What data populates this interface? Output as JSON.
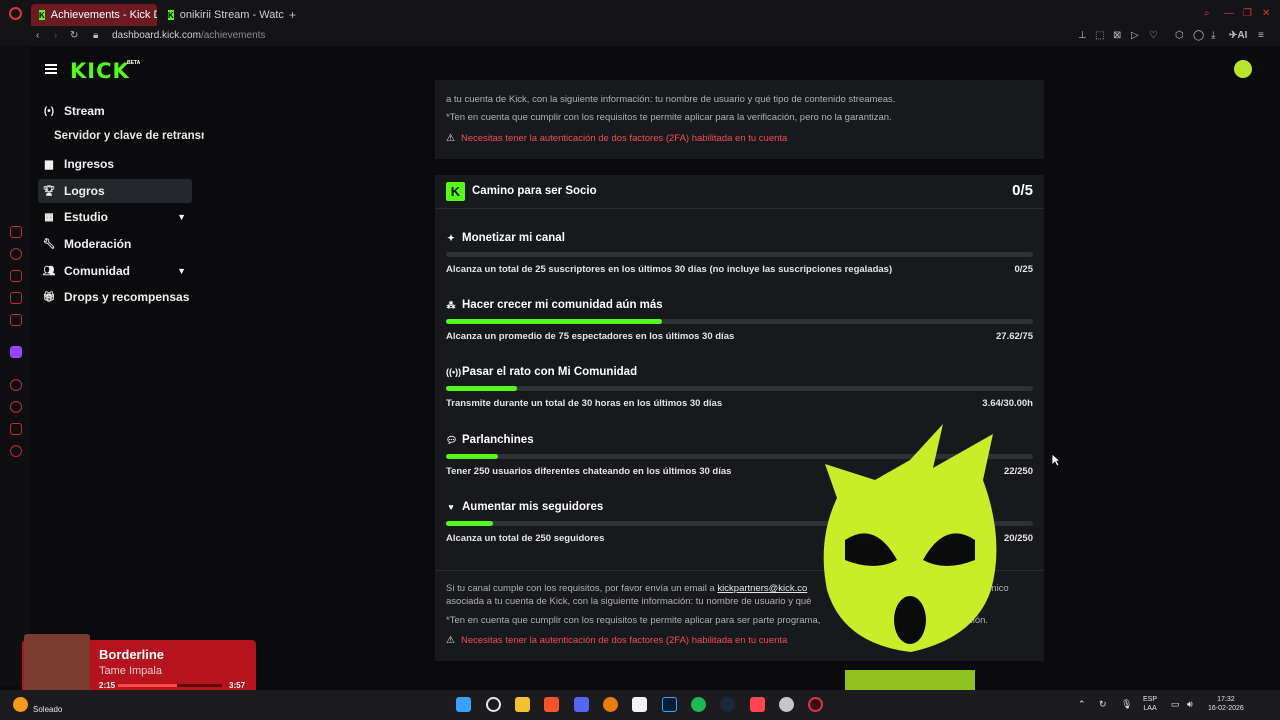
{
  "browser": {
    "tabs": [
      {
        "label": "Achievements - Kick Dash"
      },
      {
        "label": "onikirii Stream - Watch Liv"
      }
    ],
    "new_tab": "+",
    "url_domain": "dashboard.kick.com",
    "url_path": "/achievements"
  },
  "header": {
    "logo": "KICK",
    "logo_beta": "BETA"
  },
  "nav": {
    "items": [
      {
        "label": "Stream",
        "icon": "broadcast-icon"
      },
      {
        "label": "Servidor y clave de retransmisión",
        "icon": ""
      },
      {
        "label": "Ingresos",
        "icon": "chart-icon"
      },
      {
        "label": "Logros",
        "icon": "trophy-icon"
      },
      {
        "label": "Estudio",
        "icon": "studio-icon"
      },
      {
        "label": "Moderación",
        "icon": "wrench-icon"
      },
      {
        "label": "Comunidad",
        "icon": "people-icon"
      },
      {
        "label": "Drops y recompensas",
        "icon": "gift-icon"
      }
    ],
    "active": "Logros"
  },
  "top_card": {
    "line1": "a tu cuenta de Kick, con la siguiente información: tu nombre de usuario y qué tipo de contenido streameas.",
    "line2": "*Ten en cuenta que cumplir con los requisitos te permite aplicar para la verificación, pero no la garantizan.",
    "warning": "Necesitas tener la autenticación de dos factores (2FA) habilitada en tu cuenta"
  },
  "partner_card": {
    "title": "Camino para ser Socio",
    "count": "0/5",
    "goals": [
      {
        "title": "Monetizar mi canal",
        "icon": "sparkle-icon",
        "desc": "Alcanza un total de 25 suscriptores en los últimos 30 días (no incluye las suscripciones regaladas)",
        "value": "0/25",
        "progress": 0.0
      },
      {
        "title": "Hacer crecer mi comunidad aún más",
        "icon": "group-icon",
        "desc": "Alcanza un promedio de 75 espectadores en los últimos 30 días",
        "value": "27.62/75",
        "progress": 0.368
      },
      {
        "title": "Pasar el rato con Mi Comunidad",
        "icon": "broadcast-icon",
        "desc": "Transmite durante un total de 30 horas en los últimos 30 días",
        "value": "3.64/30.00h",
        "progress": 0.121
      },
      {
        "title": "Parlanchines",
        "icon": "chat-icon",
        "desc": "Tener 250 usuarios diferentes chateando en los últimos 30 días",
        "value": "22/250",
        "progress": 0.088
      },
      {
        "title": "Aumentar mis seguidores",
        "icon": "heart-icon",
        "desc": "Alcanza un total de 250 seguidores",
        "value": "20/250",
        "progress": 0.08
      }
    ],
    "footer_line1_pre": "Si tu canal cumple con los requisitos, por favor envía un email a",
    "footer_email": "kickpartners@kick.co",
    "footer_line1_post": "ónico",
    "footer_line2": "asociada a tu cuenta de Kick, con la siguiente información: tu nombre de usuario y qué",
    "footer_line3": "*Ten en cuenta que cumplir con los requisitos te permite aplicar para ser parte programa,",
    "footer_line3_end": "ción.",
    "warning": "Necesitas tener la autenticación de dos factores (2FA) habilitada en tu cuenta"
  },
  "player": {
    "song": "Borderline",
    "artist": "Tame Impala",
    "elapsed": "2:15",
    "duration": "3:57",
    "progress": 0.57
  },
  "taskbar": {
    "weather": "Soleado",
    "lang1": "ESP",
    "lang2": "LAA",
    "time": "17:32",
    "date": "16-02-2026"
  },
  "colors": {
    "accent": "#53fc18",
    "warning": "#ef4f54",
    "tab_active": "#6d1a22",
    "player_bg": "#b5141e"
  }
}
